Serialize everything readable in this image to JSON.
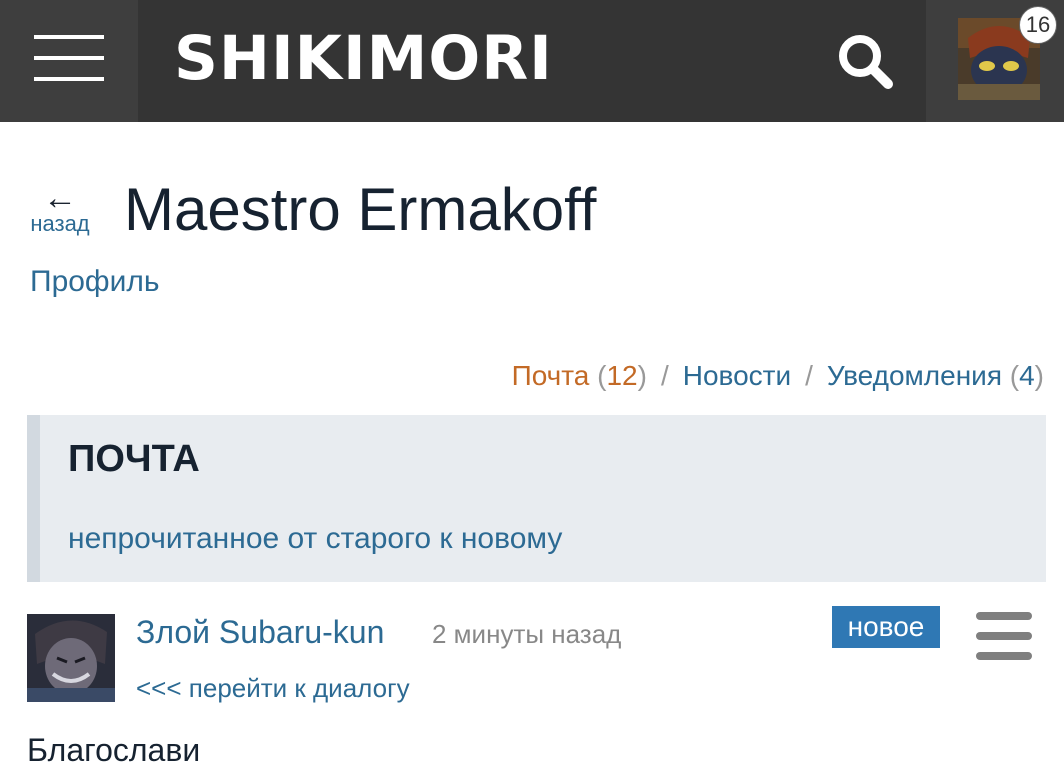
{
  "header": {
    "logo": "SHIKIMORI",
    "menu_icon": "hamburger-icon",
    "search_icon": "search-icon",
    "notification_count": "16",
    "bar_color": "#343434"
  },
  "page": {
    "back_label": "назад",
    "title": "Maestro Ermakoff",
    "profile_link": "Профиль"
  },
  "subnav": {
    "mail_label": "Почта",
    "mail_count": "12",
    "news_label": "Новости",
    "notifications_label": "Уведомления",
    "notifications_count": "4",
    "separator": "/",
    "active_color": "#c36a26",
    "link_color": "#2c6a93"
  },
  "mail": {
    "heading": "ПОЧТА",
    "sort_link": "непрочитанное от старого к новому"
  },
  "message": {
    "author": "Злой Subaru-kun",
    "time": "2 минуты назад",
    "badge": "новое",
    "dialog_link": "<<< перейти к диалогу",
    "body": "Благослави",
    "badge_color": "#2f78b4"
  }
}
